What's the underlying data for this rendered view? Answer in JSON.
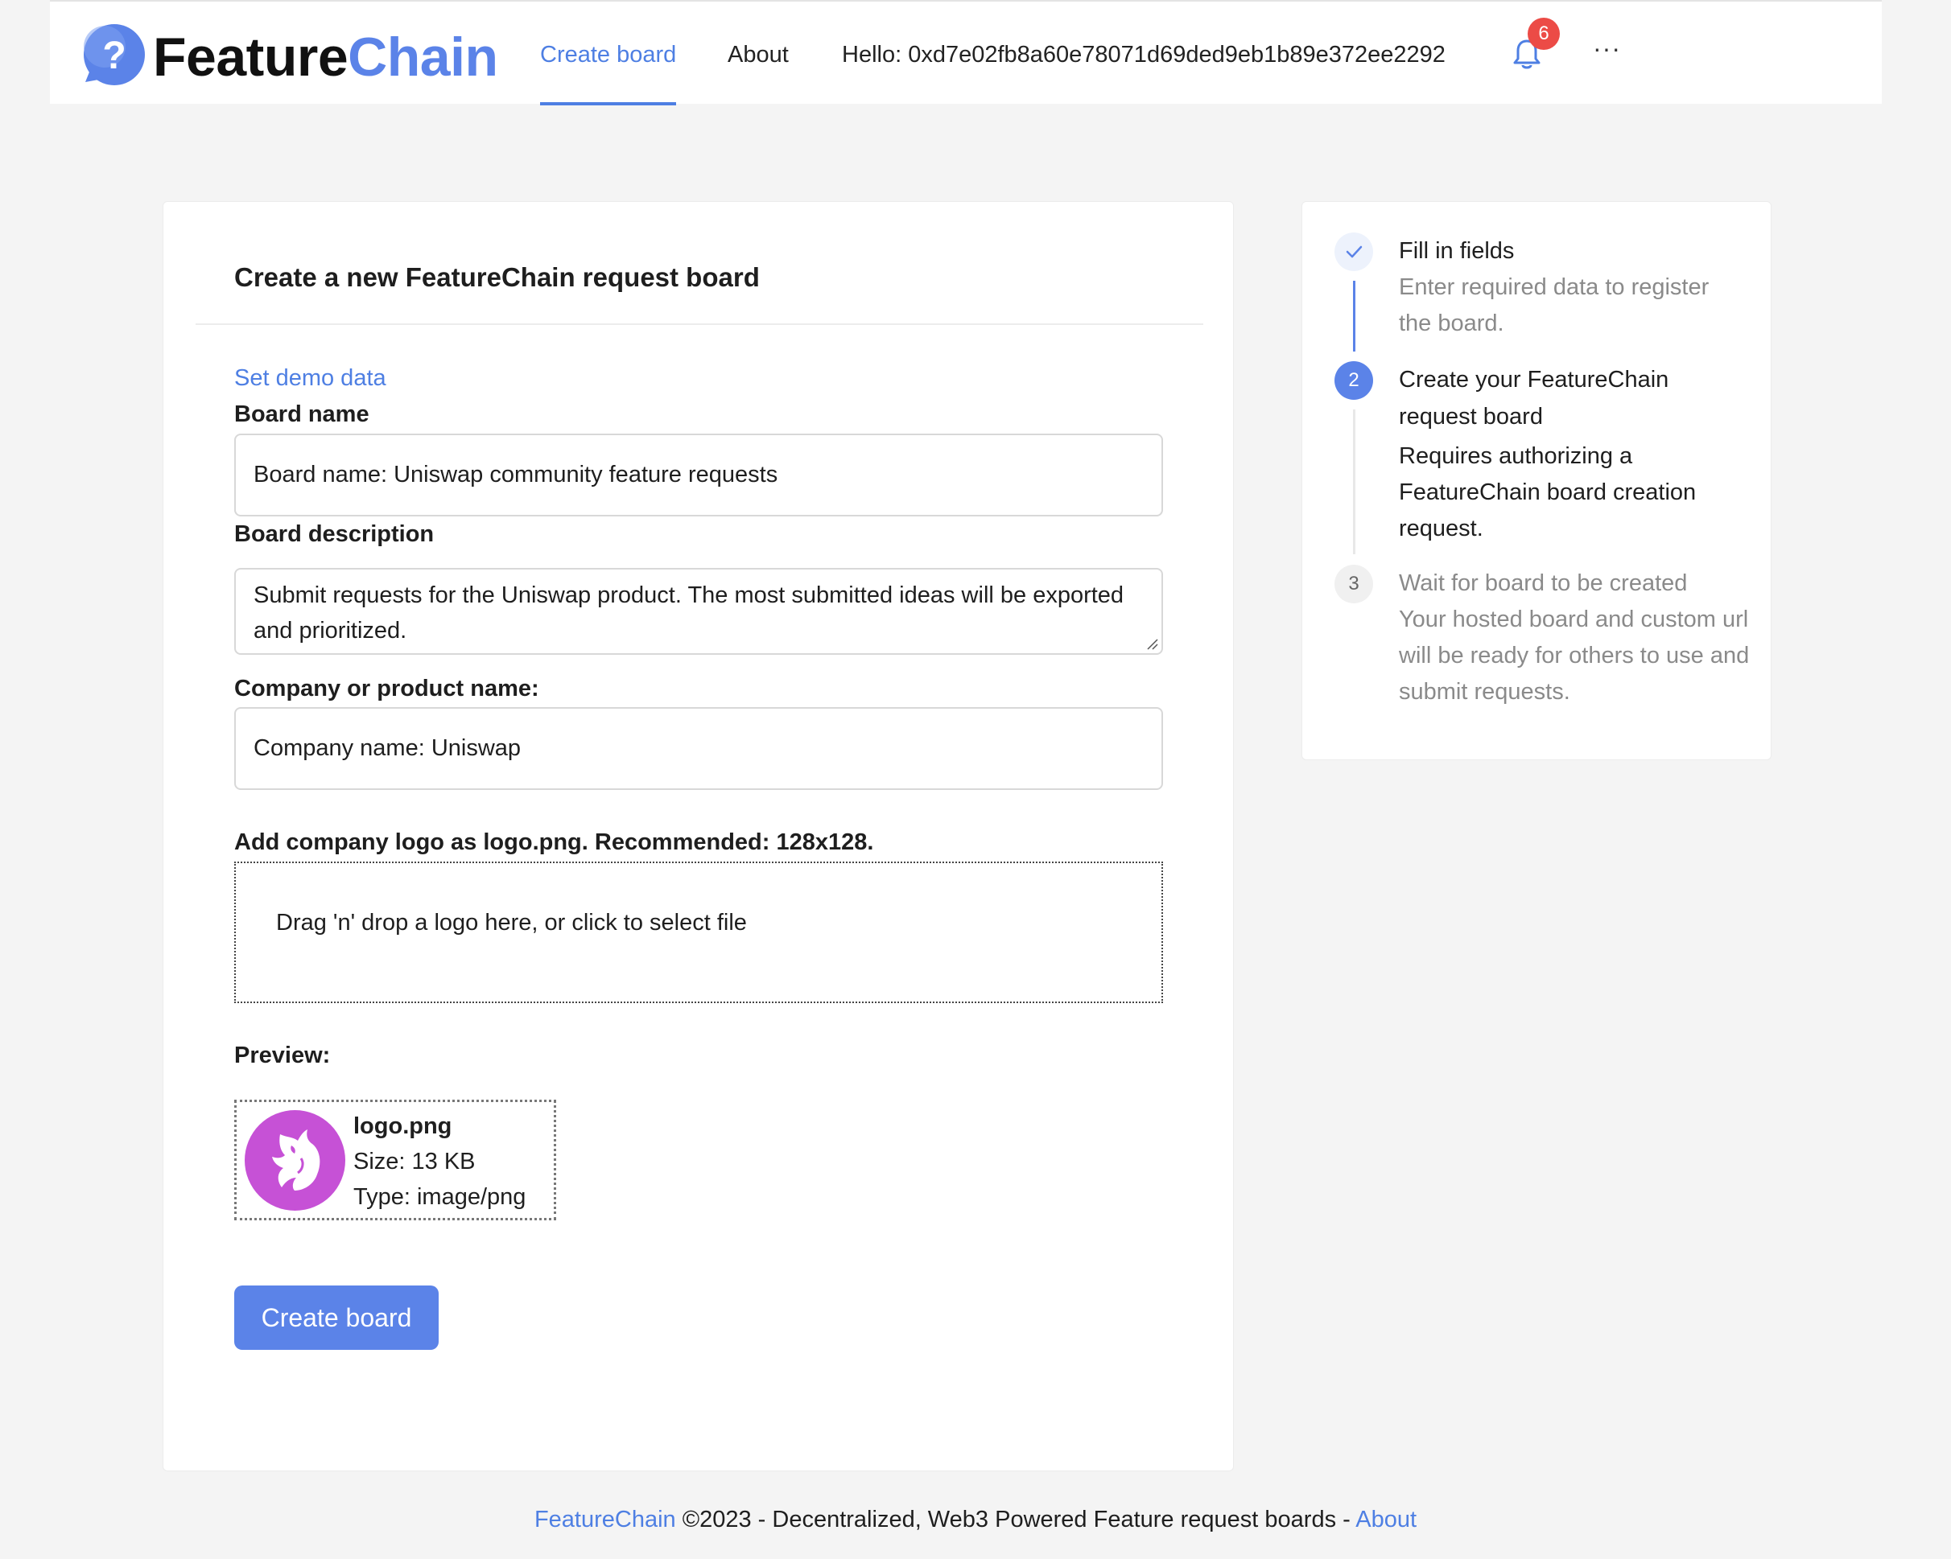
{
  "brand": {
    "name_part1": "Feature",
    "name_part2": "Chain",
    "colors": {
      "accent": "#5b83e8",
      "link": "#4e7fe3",
      "badge": "#ec4b46",
      "preview_logo_bg": "#c651d6"
    }
  },
  "nav": {
    "create_board": "Create board",
    "about": "About",
    "greeting": "Hello: 0xd7e02fb8a60e78071d69ded9eb1b89e372ee2292",
    "notifications_count": "6",
    "more_label": "···",
    "icons": {
      "logo": "question-bubble-icon",
      "notifications": "bell-icon"
    }
  },
  "form": {
    "title": "Create a new FeatureChain request board",
    "demo_link": "Set demo data",
    "board_name_label": "Board name",
    "board_name_value": "Board name: Uniswap community feature requests",
    "board_description_label": "Board description",
    "board_description_value": "Submit requests for the Uniswap product. The most submitted ideas will be exported and prioritized.",
    "company_label": "Company or product name:",
    "company_value": "Company name: Uniswap",
    "logo_label": "Add company logo as logo.png. Recommended: 128x128.",
    "dropzone_text": "Drag 'n' drop a logo here, or click to select file",
    "preview_label": "Preview:",
    "preview": {
      "file_name": "logo.png",
      "size": "Size: 13 KB",
      "type": "Type: image/png",
      "image_icon": "unicorn-logo-icon"
    },
    "submit_label": "Create board"
  },
  "steps": [
    {
      "number": "1",
      "status": "done",
      "title": "Fill in fields",
      "description": "Enter required data to register the board."
    },
    {
      "number": "2",
      "status": "active",
      "title": "Create your FeatureChain request board",
      "description": "Requires authorizing a FeatureChain board creation request."
    },
    {
      "number": "3",
      "status": "pending",
      "title": "Wait for board to be created",
      "description": "Your hosted board and custom url will be ready for others to use and submit requests."
    }
  ],
  "footer": {
    "brand_link": "FeatureChain",
    "text": " ©2023 - Decentralized, Web3 Powered Feature request boards - ",
    "about_link": "About"
  }
}
